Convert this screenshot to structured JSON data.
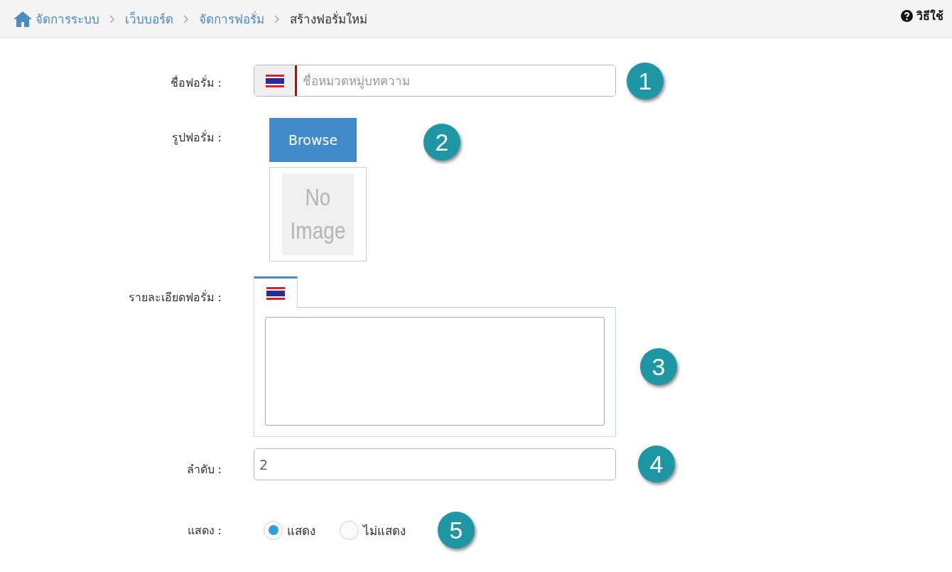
{
  "breadcrumb": [
    {
      "label": "จัดการระบบ",
      "current": false
    },
    {
      "label": "เว็บบอร์ด",
      "current": false
    },
    {
      "label": "จัดการฟอรั่ม",
      "current": false
    },
    {
      "label": "สร้างฟอรั่มใหม่",
      "current": true
    }
  ],
  "help": {
    "label": "วิธีใช้"
  },
  "form": {
    "name": {
      "label": "ชื่อฟอรั่ม :",
      "placeholder": "ชื่อหมวดหมู่บทความ",
      "badge": "1"
    },
    "image": {
      "label": "รูปฟอรั่ม :",
      "button": "Browse",
      "no_image": [
        "No",
        "Image"
      ],
      "badge": "2"
    },
    "detail": {
      "label": "รายละเอียดฟอรั่ม :",
      "badge": "3"
    },
    "order": {
      "label": "ลำดับ :",
      "value": "2",
      "badge": "4"
    },
    "show": {
      "label": "แสดง :",
      "options": [
        {
          "label": "แสดง",
          "selected": true
        },
        {
          "label": "ไม่แสดง",
          "selected": false
        }
      ],
      "badge": "5"
    }
  }
}
